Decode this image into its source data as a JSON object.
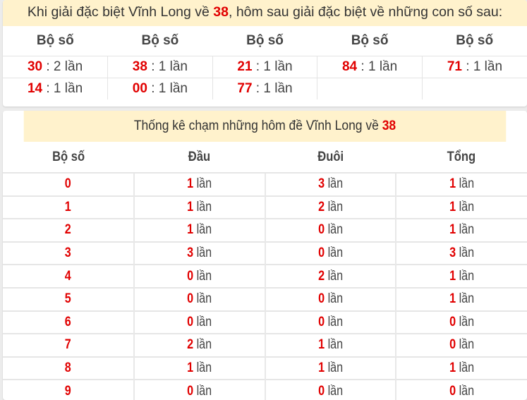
{
  "section1": {
    "title_prefix": "Khi giải đặc biệt Vĩnh Long về ",
    "title_number": "38",
    "title_suffix": ", hôm sau giải đặc biệt về những con số sau:",
    "column_header": "Bộ số",
    "columns": 5,
    "unit": "lần",
    "rows": [
      [
        {
          "number": "30",
          "count": "2"
        },
        {
          "number": "38",
          "count": "1"
        },
        {
          "number": "21",
          "count": "1"
        },
        {
          "number": "84",
          "count": "1"
        },
        {
          "number": "71",
          "count": "1"
        }
      ],
      [
        {
          "number": "14",
          "count": "1"
        },
        {
          "number": "00",
          "count": "1"
        },
        {
          "number": "77",
          "count": "1"
        },
        null,
        null
      ]
    ]
  },
  "section2": {
    "title_prefix": "Thống kê chạm những hôm đề Vĩnh Long về ",
    "title_number": "38",
    "headers": [
      "Bộ số",
      "Đầu",
      "Đuôi",
      "Tổng"
    ],
    "unit": "lần",
    "rows": [
      {
        "digit": "0",
        "dau": "1",
        "duoi": "3",
        "tong": "1"
      },
      {
        "digit": "1",
        "dau": "1",
        "duoi": "2",
        "tong": "1"
      },
      {
        "digit": "2",
        "dau": "1",
        "duoi": "0",
        "tong": "1"
      },
      {
        "digit": "3",
        "dau": "3",
        "duoi": "0",
        "tong": "3"
      },
      {
        "digit": "4",
        "dau": "0",
        "duoi": "2",
        "tong": "1"
      },
      {
        "digit": "5",
        "dau": "0",
        "duoi": "0",
        "tong": "1"
      },
      {
        "digit": "6",
        "dau": "0",
        "duoi": "0",
        "tong": "0"
      },
      {
        "digit": "7",
        "dau": "2",
        "duoi": "1",
        "tong": "0"
      },
      {
        "digit": "8",
        "dau": "1",
        "duoi": "1",
        "tong": "1"
      },
      {
        "digit": "9",
        "dau": "0",
        "duoi": "0",
        "tong": "0"
      }
    ]
  },
  "colors": {
    "accent_red": "#e10000",
    "header_bg": "#fff2cc",
    "page_bg": "#ececec"
  }
}
